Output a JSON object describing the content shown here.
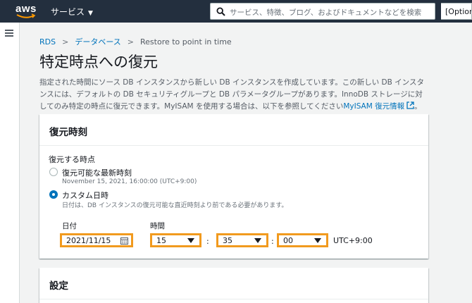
{
  "topnav": {
    "logo_text": "aws",
    "services_label": "サービス",
    "search_placeholder": "サービス、特徴、ブログ、およびドキュメントなどを検索",
    "option_label": "[Option"
  },
  "breadcrumb": {
    "items": [
      "RDS",
      "データベース",
      "Restore to point in time"
    ]
  },
  "page": {
    "title": "特定時点への復元",
    "description": "指定された時間にソース DB インスタンスから新しい DB インスタンスを作成しています。この新しい DB インスタンスには、デフォルトの DB セキュリティグループと DB パラメータグループがあります。InnoDB ストレージに対してのみ特定の時点に復元できます。MyISAM を使用する場合は、以下を参照してください",
    "description_link": "MyISAM 復元情報"
  },
  "restore_panel": {
    "title": "復元時刻",
    "field_label": "復元する時点",
    "options": [
      {
        "label": "復元可能な最新時刻",
        "description": "November 15, 2021, 16:00:00 (UTC+9:00)",
        "selected": false
      },
      {
        "label": "カスタム日時",
        "description": "日付は、DB インスタンスの復元可能な直近時刻より前である必要があります。",
        "selected": true
      }
    ],
    "date_label": "日付",
    "time_label": "時間",
    "date_value": "2021/11/15",
    "hour_value": "15",
    "minute_value": "35",
    "second_value": "00",
    "colon": ":",
    "timezone": "UTC+9:00"
  },
  "settings_panel": {
    "title": "設定"
  },
  "colors": {
    "nav_bg": "#232f3e",
    "link": "#0073bb",
    "highlight": "#f19a1e"
  }
}
